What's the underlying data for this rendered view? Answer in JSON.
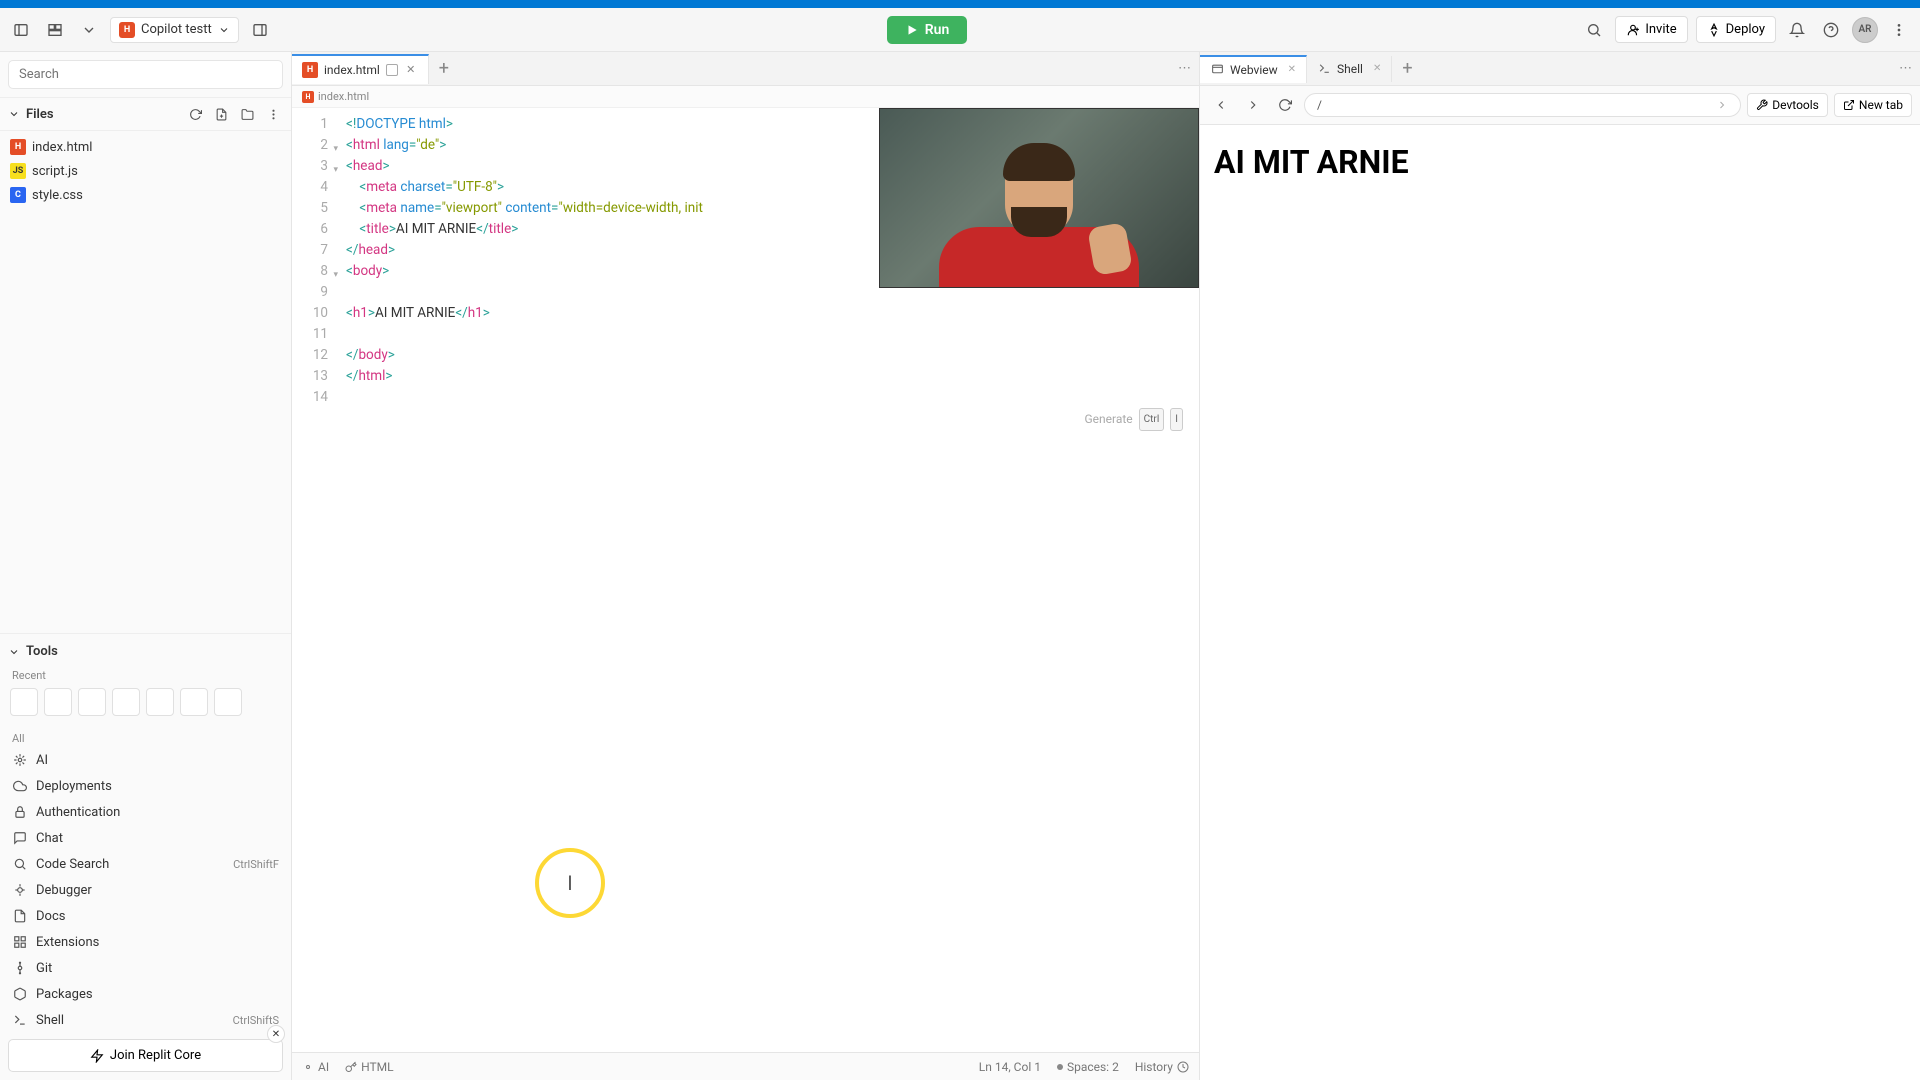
{
  "header": {
    "project_name": "Copilot testt",
    "run_label": "Run",
    "invite_label": "Invite",
    "deploy_label": "Deploy",
    "avatar_initials": "AR"
  },
  "sidebar": {
    "search_placeholder": "Search",
    "files_label": "Files",
    "files": [
      {
        "name": "index.html",
        "icon_class": "fi-html",
        "icon_text": "H"
      },
      {
        "name": "script.js",
        "icon_class": "fi-js",
        "icon_text": "JS"
      },
      {
        "name": "style.css",
        "icon_class": "fi-css",
        "icon_text": "C"
      }
    ],
    "tools_label": "Tools",
    "recent_label": "Recent",
    "all_label": "All",
    "tools": [
      {
        "name": "AI",
        "icon": "ai",
        "shortcut": ""
      },
      {
        "name": "Deployments",
        "icon": "cloud",
        "shortcut": ""
      },
      {
        "name": "Authentication",
        "icon": "lock",
        "shortcut": ""
      },
      {
        "name": "Chat",
        "icon": "chat",
        "shortcut": ""
      },
      {
        "name": "Code Search",
        "icon": "search",
        "shortcut": "CtrlShiftF"
      },
      {
        "name": "Debugger",
        "icon": "bug",
        "shortcut": ""
      },
      {
        "name": "Docs",
        "icon": "doc",
        "shortcut": ""
      },
      {
        "name": "Extensions",
        "icon": "ext",
        "shortcut": ""
      },
      {
        "name": "Git",
        "icon": "git",
        "shortcut": ""
      },
      {
        "name": "Packages",
        "icon": "pkg",
        "shortcut": ""
      },
      {
        "name": "Shell",
        "icon": "shell",
        "shortcut": "CtrlShiftS"
      }
    ],
    "upsell_label": "Join Replit Core"
  },
  "editor": {
    "tab_name": "index.html",
    "breadcrumb": "index.html",
    "generate_label": "Generate",
    "generate_kbd1": "Ctrl",
    "generate_kbd2": "I",
    "gutter": [
      "1",
      "2",
      "3",
      "4",
      "5",
      "6",
      "7",
      "8",
      "9",
      "10",
      "11",
      "12",
      "13",
      "14"
    ],
    "code_tokens": [
      [
        [
          "<!",
          "t-tag"
        ],
        [
          "DOCTYPE html",
          "t-attr"
        ],
        [
          ">",
          "t-tag"
        ]
      ],
      [
        [
          "<",
          "t-tag"
        ],
        [
          "html",
          "t-name"
        ],
        [
          " lang",
          "t-attr"
        ],
        [
          "=",
          "t-tag"
        ],
        [
          "\"de\"",
          "t-str"
        ],
        [
          ">",
          "t-tag"
        ]
      ],
      [
        [
          "<",
          "t-tag"
        ],
        [
          "head",
          "t-name"
        ],
        [
          ">",
          "t-tag"
        ]
      ],
      [
        [
          "    <",
          "t-tag"
        ],
        [
          "meta",
          "t-name"
        ],
        [
          " charset",
          "t-attr"
        ],
        [
          "=",
          "t-tag"
        ],
        [
          "\"UTF-8\"",
          "t-str"
        ],
        [
          ">",
          "t-tag"
        ]
      ],
      [
        [
          "    <",
          "t-tag"
        ],
        [
          "meta",
          "t-name"
        ],
        [
          " name",
          "t-attr"
        ],
        [
          "=",
          "t-tag"
        ],
        [
          "\"viewport\"",
          "t-str"
        ],
        [
          " content",
          "t-attr"
        ],
        [
          "=",
          "t-tag"
        ],
        [
          "\"width=device-width, init",
          "t-str"
        ]
      ],
      [
        [
          "    <",
          "t-tag"
        ],
        [
          "title",
          "t-name"
        ],
        [
          ">",
          "t-tag"
        ],
        [
          "AI MIT ARNIE",
          "t-txt"
        ],
        [
          "</",
          "t-tag"
        ],
        [
          "title",
          "t-name"
        ],
        [
          ">",
          "t-tag"
        ]
      ],
      [
        [
          "</",
          "t-tag"
        ],
        [
          "head",
          "t-name"
        ],
        [
          ">",
          "t-tag"
        ]
      ],
      [
        [
          "<",
          "t-tag"
        ],
        [
          "body",
          "t-name"
        ],
        [
          ">",
          "t-tag"
        ]
      ],
      [
        [
          "",
          "t-txt"
        ]
      ],
      [
        [
          "<",
          "t-tag"
        ],
        [
          "h1",
          "t-name"
        ],
        [
          ">",
          "t-tag"
        ],
        [
          "AI MIT ARNIE",
          "t-txt"
        ],
        [
          "</",
          "t-tag"
        ],
        [
          "h1",
          "t-name"
        ],
        [
          ">",
          "t-tag"
        ]
      ],
      [
        [
          "",
          "t-txt"
        ]
      ],
      [
        [
          "</",
          "t-tag"
        ],
        [
          "body",
          "t-name"
        ],
        [
          ">",
          "t-tag"
        ]
      ],
      [
        [
          "</",
          "t-tag"
        ],
        [
          "html",
          "t-name"
        ],
        [
          ">",
          "t-tag"
        ]
      ],
      [
        [
          "",
          "t-txt"
        ]
      ]
    ],
    "fold_lines": [
      2,
      3,
      8
    ]
  },
  "status": {
    "ai_label": "AI",
    "lang_label": "HTML",
    "cursor_label": "Ln 14, Col 1",
    "spaces_label": "Spaces: 2",
    "history_label": "History"
  },
  "preview": {
    "tabs": {
      "webview": "Webview",
      "shell": "Shell"
    },
    "url": "/",
    "devtools_label": "Devtools",
    "newtab_label": "New tab",
    "heading": "AI MIT ARNIE"
  },
  "highlight_cursor_text": "I"
}
